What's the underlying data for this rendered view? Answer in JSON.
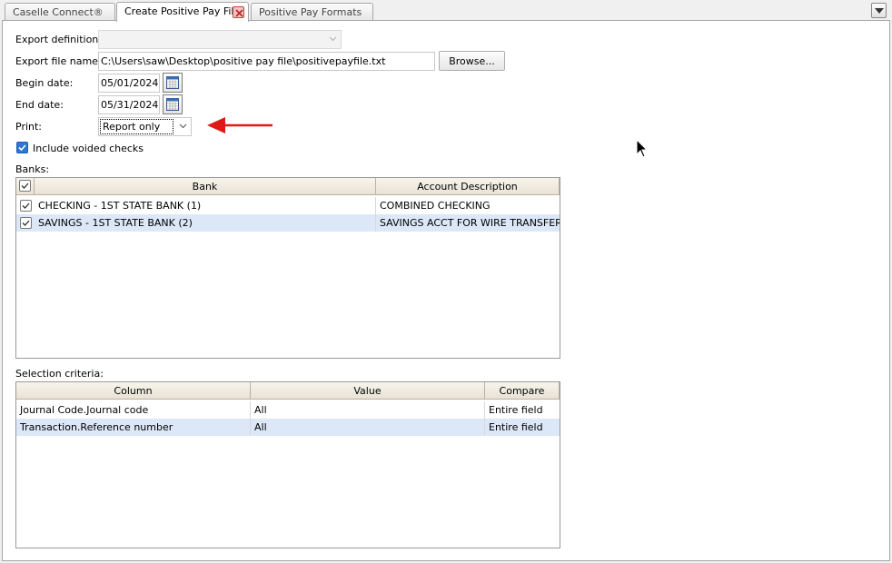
{
  "tabs": [
    {
      "label": "Caselle Connect®"
    },
    {
      "label": "Create Positive Pay File"
    },
    {
      "label": "Positive Pay Formats"
    }
  ],
  "form": {
    "export_definition_label": "Export definition:",
    "export_definition_value": "",
    "export_file_label": "Export file name:",
    "export_file_value": "C:\\Users\\saw\\Desktop\\positive pay file\\positivepayfile.txt",
    "browse_label": "Browse...",
    "begin_date_label": "Begin date:",
    "begin_date_value": "05/01/2024",
    "end_date_label": "End date:",
    "end_date_value": "05/31/2024",
    "print_label": "Print:",
    "print_value": "Report only",
    "include_voided_label": "Include voided checks",
    "include_voided_checked": true
  },
  "banks": {
    "label": "Banks:",
    "columns": [
      "Bank",
      "Account Description"
    ],
    "rows": [
      {
        "checked": true,
        "bank": "CHECKING - 1ST STATE BANK (1)",
        "description": "COMBINED CHECKING"
      },
      {
        "checked": true,
        "bank": "SAVINGS - 1ST STATE BANK (2)",
        "description": "SAVINGS ACCT FOR WIRE TRANSFER"
      }
    ]
  },
  "selection": {
    "label": "Selection criteria:",
    "columns": [
      "Column",
      "Value",
      "Compare"
    ],
    "rows": [
      {
        "column": "Journal Code.Journal code",
        "value": "All",
        "compare": "Entire field"
      },
      {
        "column": "Transaction.Reference number",
        "value": "All",
        "compare": "Entire field"
      }
    ]
  },
  "colors": {
    "annotation_arrow": "#e01818",
    "selected_row": "#dce7f7",
    "checkbox_accent": "#2f77d0"
  }
}
